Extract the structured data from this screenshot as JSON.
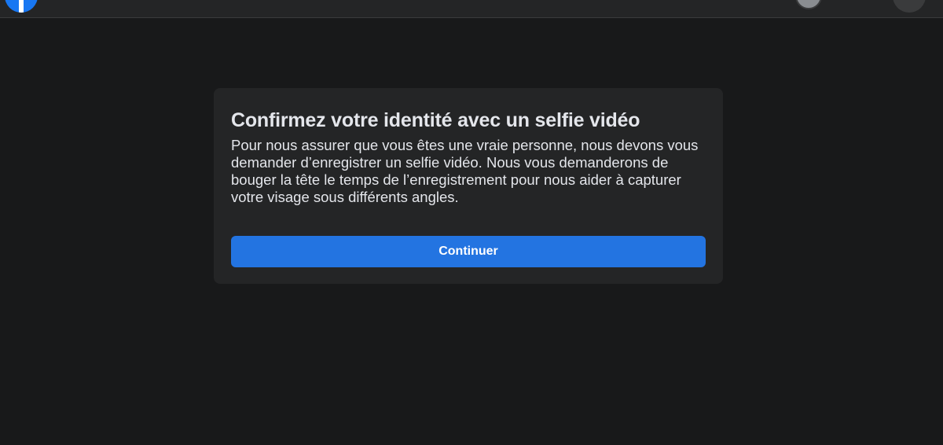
{
  "header": {
    "logo_icon": "facebook-logo-icon",
    "profile_icon": "avatar",
    "menu_icon": "account-menu-icon"
  },
  "dialog": {
    "title": "Confirmez votre identité avec un selfie vidéo",
    "body": "Pour nous assurer que vous êtes une vraie personne, nous devons vous demander d’enregistrer un selfie vidéo. Nous vous demanderons de bouger la tête le temps de l’enregistrement pour nous aider à capturer votre visage sous différents angles.",
    "continue_label": "Continuer"
  },
  "colors": {
    "page_background": "#18191a",
    "card_background": "#242526",
    "text_primary": "#e4e6eb",
    "accent": "#2374e1",
    "brand": "#1877f2"
  }
}
